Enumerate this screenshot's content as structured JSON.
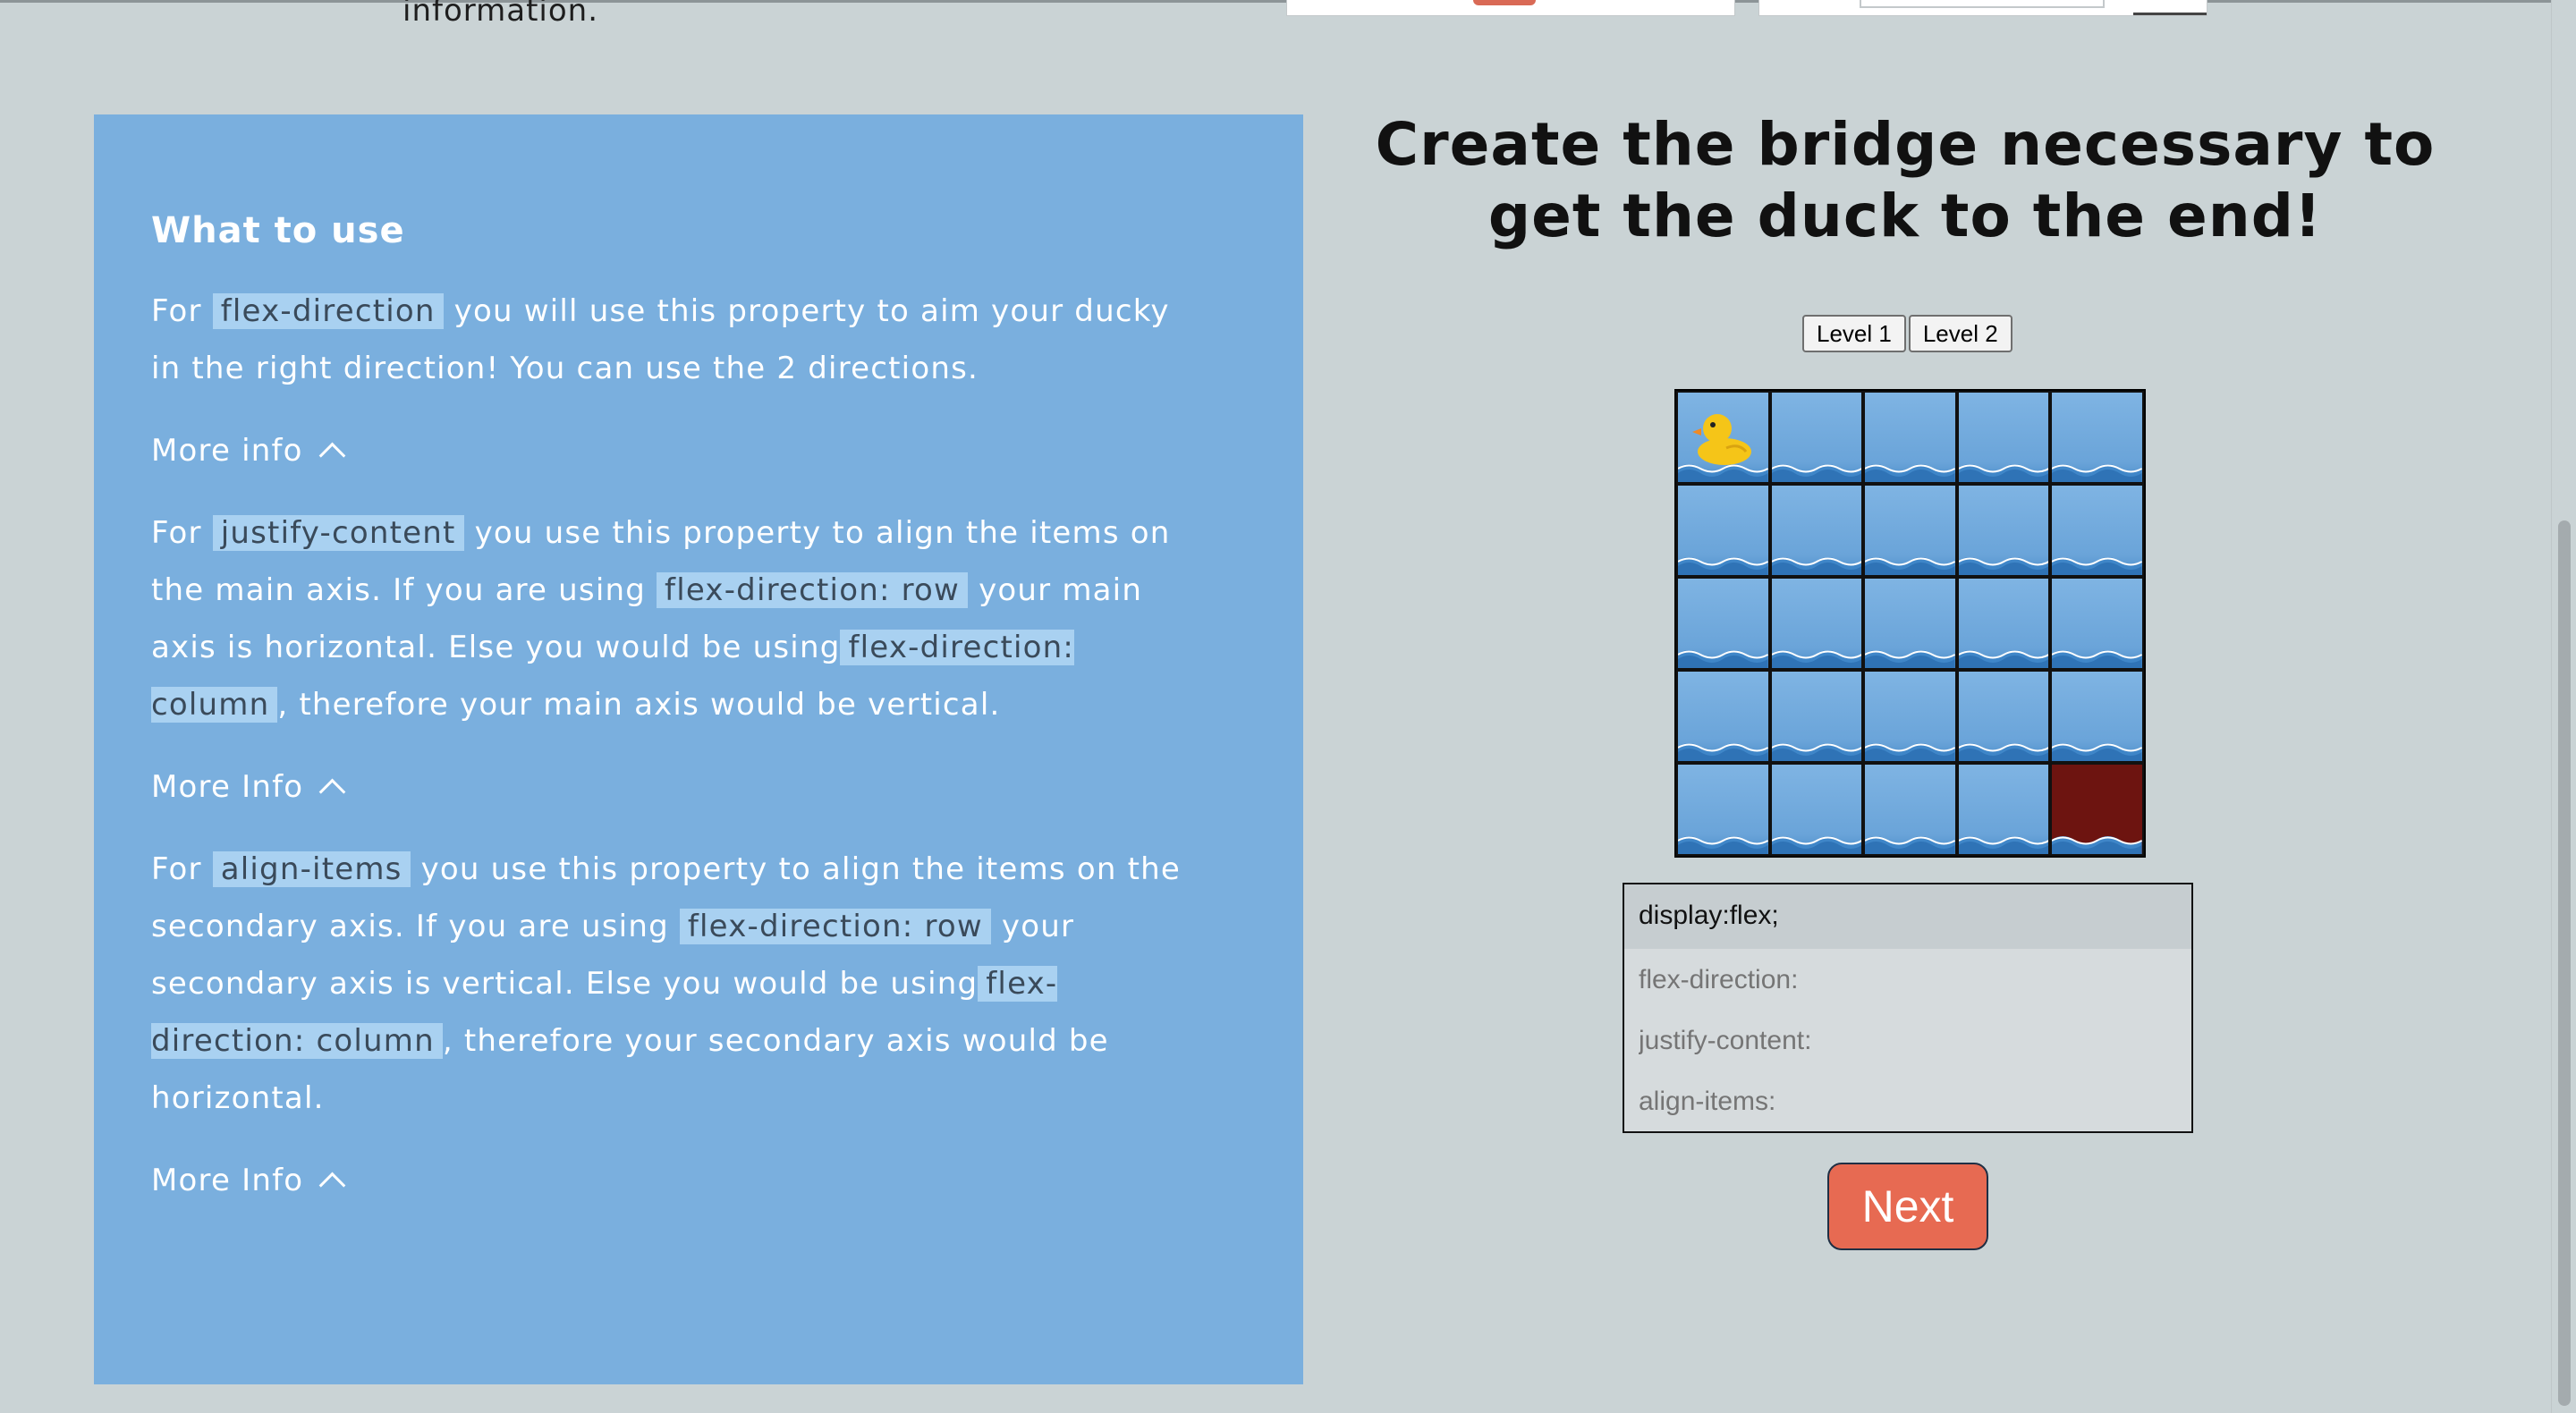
{
  "top": {
    "prev_text": "information."
  },
  "left_panel": {
    "title": "What to use",
    "sections": [
      {
        "parts": [
          "For ",
          "flex-direction",
          " you will use this property to aim your ducky in the right direction! You can use the 2 directions."
        ],
        "more_label": "More info"
      },
      {
        "parts": [
          "For ",
          "justify-content",
          " you use this property to align the items on the main axis. If you are using ",
          "flex-direction: row",
          " your main axis is horizontal. Else you would be using",
          "flex-direction: column",
          ", therefore your main axis would be vertical."
        ],
        "more_label": "More Info"
      },
      {
        "parts": [
          "For ",
          "align-items",
          " you use this property to align the items on the secondary axis. If you are using ",
          "flex-direction: row",
          " your secondary axis is vertical. Else you would be using",
          "flex-direction: column",
          ", therefore your secondary axis would be horizontal."
        ],
        "more_label": "More Info"
      }
    ]
  },
  "game": {
    "title": "Create the bridge necessary to get the duck to the end!",
    "levels": [
      "Level 1",
      "Level 2"
    ],
    "board": {
      "rows": 5,
      "cols": 5,
      "duck_cell": [
        0,
        0
      ],
      "goal_cell": [
        4,
        4
      ],
      "colors": {
        "water": "#7fb4e3",
        "goal": "#6d1410",
        "duck": "#f5c518"
      }
    },
    "code": {
      "first_line": "display:flex;",
      "placeholders": [
        "flex-direction:",
        "justify-content:",
        "align-items:"
      ]
    },
    "next_label": "Next"
  },
  "colors": {
    "panel": "#7aafde",
    "code_highlight": "#a9d1f1",
    "accent": "#e76a52",
    "background": "#cad3d5"
  }
}
